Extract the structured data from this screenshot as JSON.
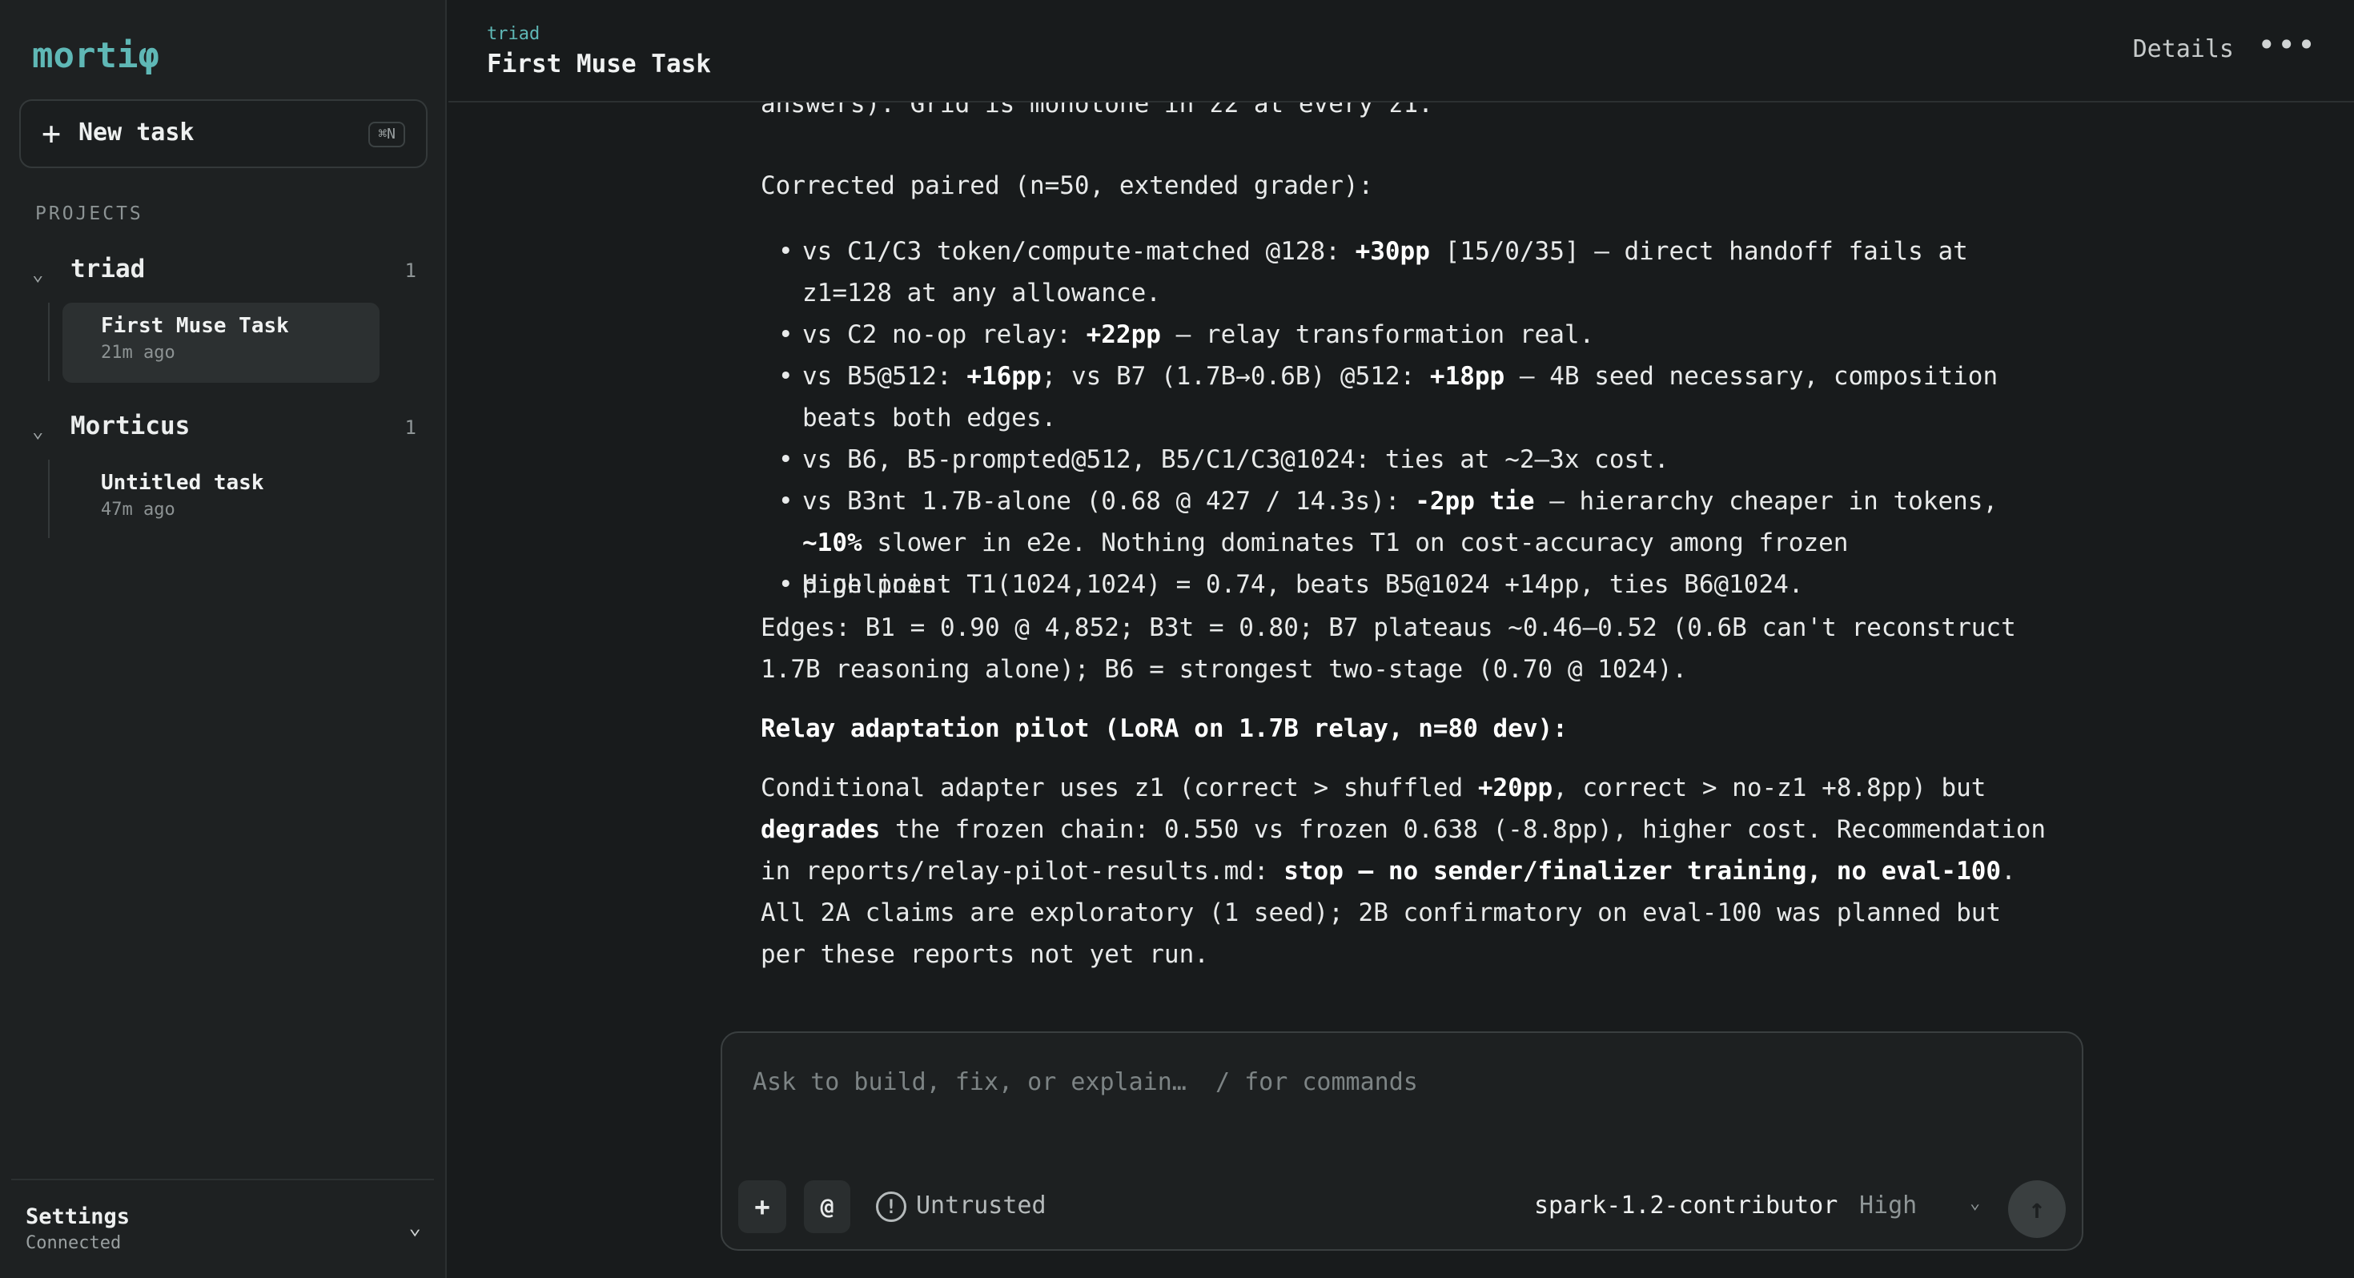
{
  "app": {
    "logo": "mortiφ"
  },
  "sidebar": {
    "new_task_label": "New task",
    "new_task_shortcut": "⌘N",
    "projects_title": "PROJECTS",
    "projects": [
      {
        "name": "triad",
        "count": "1",
        "tasks": [
          {
            "title": "First Muse Task",
            "time": "21m ago",
            "active": true
          }
        ]
      },
      {
        "name": "Morticus",
        "count": "1",
        "tasks": [
          {
            "title": "Untitled task",
            "time": "47m ago",
            "active": false
          }
        ]
      }
    ],
    "footer": {
      "settings_label": "Settings",
      "status": "Connected"
    }
  },
  "header": {
    "breadcrumb": "triad",
    "title": "First Muse Task",
    "details_label": "Details",
    "more_label": "•••"
  },
  "content": {
    "partial_line": "answers). Grid is monotone in z2 at every z1.",
    "paired_heading": "Corrected paired (n=50, extended grader):",
    "bullets": [
      {
        "pre": "vs C1/C3 token/compute-matched @128: ",
        "bold": "+30pp",
        "post": " [15/0/35] — direct handoff fails at z1=128 at any allowance."
      },
      {
        "pre": "vs C2 no-op relay: ",
        "bold": "+22pp",
        "post": " — relay transformation real."
      },
      {
        "pre": "vs B5@512: ",
        "bold": "+16pp",
        "mid": "; vs B7 (1.7B→0.6B) @512: ",
        "bold2": "+18pp",
        "post": " — 4B seed necessary, composition beats both edges."
      },
      {
        "text": "vs B6, B5-prompted@512, B5/C1/C3@1024: ties at ~2–3x cost."
      },
      {
        "pre": "vs B3nt 1.7B-alone (0.68 @ 427 / 14.3s): ",
        "bold": "-2pp tie",
        "mid": " — hierarchy cheaper in tokens, ",
        "bold2": "~10%",
        "post": " slower in e2e. Nothing dominates T1 on cost-accuracy among frozen pipelines."
      },
      {
        "text": "High point T1(1024,1024) = 0.74, beats B5@1024 +14pp, ties B6@1024."
      }
    ],
    "edges": "Edges: B1 = 0.90 @ 4,852; B3t = 0.80; B7 plateaus ~0.46–0.52 (0.6B can't reconstruct 1.7B reasoning alone); B6 = strongest two-stage (0.70 @ 1024).",
    "relay_heading": "Relay adaptation pilot (LoRA on 1.7B relay, n=80 dev):",
    "relay": {
      "p1": "Conditional adapter uses z1 (correct > shuffled ",
      "b1": "+20pp",
      "p2": ", correct > no-z1 +8.8pp) but ",
      "b2": "degrades",
      "p3": " the frozen chain: 0.550 vs frozen 0.638 (-8.8pp), higher cost. Recommendation in reports/relay-pilot-results.md: ",
      "b3": "stop — no sender/finalizer training, no eval-100",
      "p4": "."
    },
    "closing": "All 2A claims are exploratory (1 seed); 2B confirmatory on eval-100 was planned but per these reports not yet run."
  },
  "composer": {
    "placeholder": "Ask to build, fix, or explain…  / for commands",
    "value": "",
    "attach_label": "+",
    "mention_label": "@",
    "trust_label": "Untrusted",
    "model": "spark-1.2-contributor",
    "effort": "High",
    "send_label": "↑"
  },
  "icons": {
    "plus": "plus-icon",
    "chevron": "chevron-down-icon",
    "more": "more-horizontal-icon",
    "warning": "exclamation-circle-icon",
    "send": "arrow-up-icon"
  },
  "colors": {
    "accent": "#5fb8b6",
    "background": "#181b1c",
    "sidebar": "#1e2122",
    "active_item": "#2c3031"
  }
}
